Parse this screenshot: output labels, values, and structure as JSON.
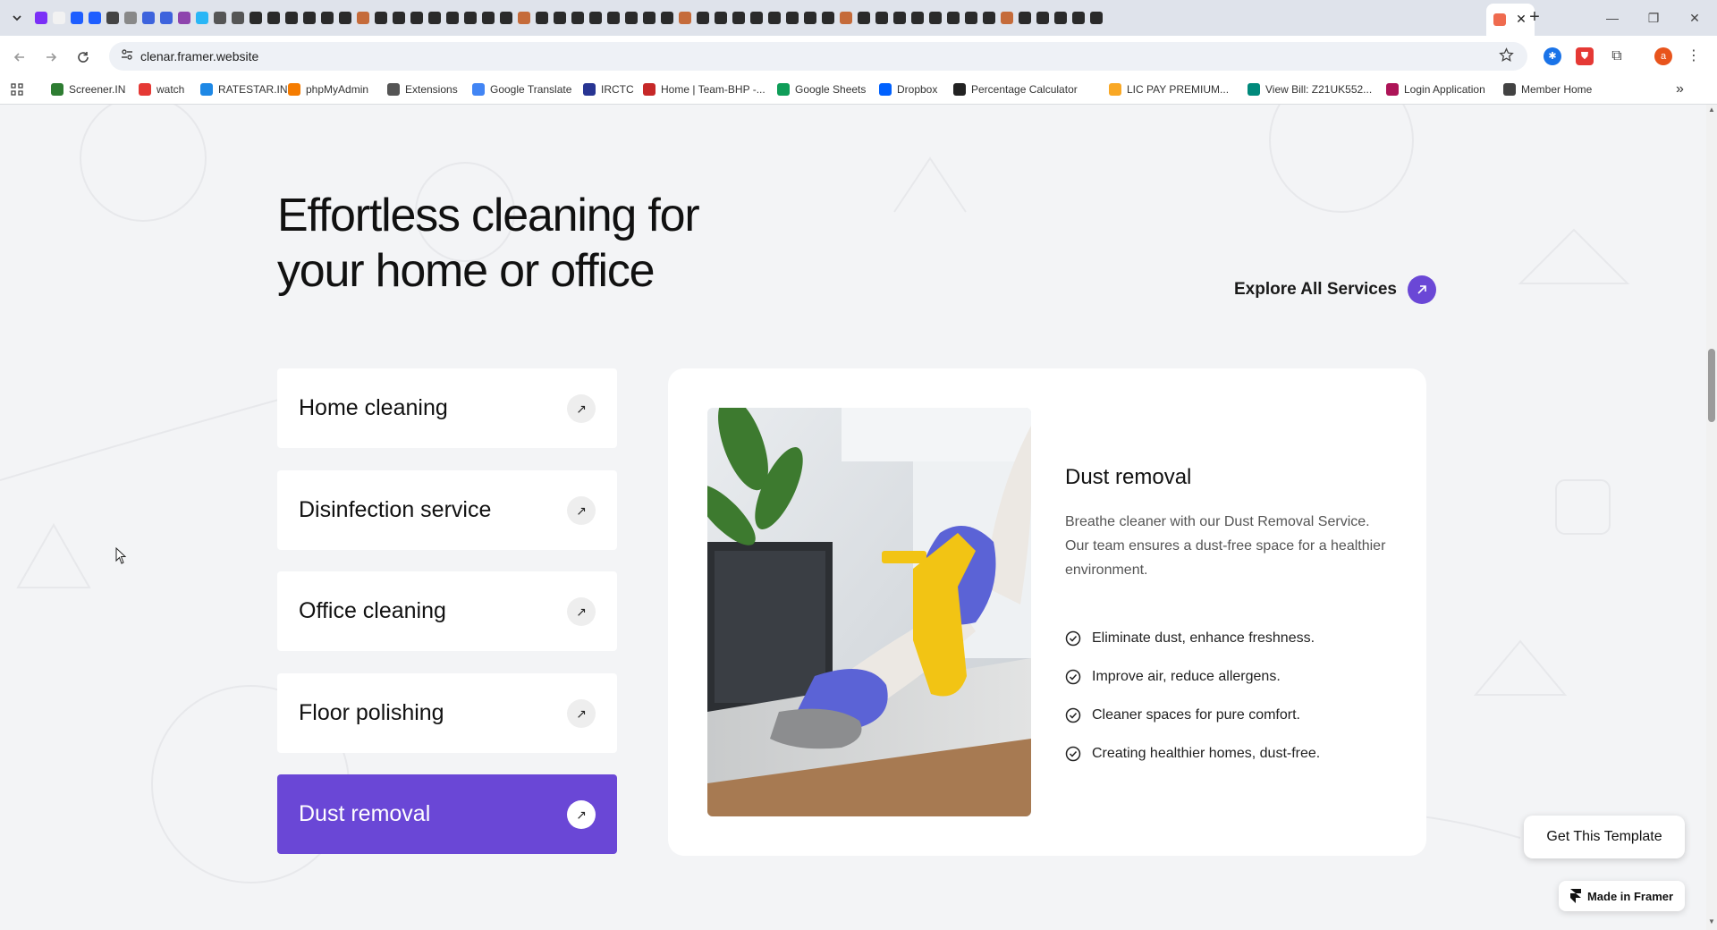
{
  "browser": {
    "tab_count_favicons": 60,
    "active_tab_close": "✕",
    "new_tab": "+",
    "window_controls": {
      "minimize": "—",
      "restore": "❐",
      "close": "✕"
    },
    "url": "clenar.framer.website",
    "profile_initial": "a",
    "icons": {
      "back": "arrow-left-icon",
      "forward": "arrow-right-icon",
      "reload": "reload-icon",
      "site_info": "tune-icon",
      "bookmark": "star-icon",
      "apps": "apps-grid-icon",
      "more_bookmarks": "chevron-double-right-icon"
    },
    "bookmarks": [
      {
        "label": "Screener.IN",
        "color": "#2e7d32"
      },
      {
        "label": "watch",
        "color": "#e53935"
      },
      {
        "label": "RATESTAR.IN",
        "color": "#1e88e5"
      },
      {
        "label": "phpMyAdmin",
        "color": "#f57c00"
      },
      {
        "label": "Extensions",
        "color": "#555555"
      },
      {
        "label": "Google Translate",
        "color": "#4285f4"
      },
      {
        "label": "IRCTC",
        "color": "#283593"
      },
      {
        "label": "Home | Team-BHP -...",
        "color": "#c62828"
      },
      {
        "label": "Google Sheets",
        "color": "#0f9d58"
      },
      {
        "label": "Dropbox",
        "color": "#0061fe"
      },
      {
        "label": "Percentage Calculator",
        "color": "#222222"
      },
      {
        "label": "LIC PAY PREMIUM...",
        "color": "#f9a825"
      },
      {
        "label": "View Bill: Z21UK552...",
        "color": "#00897b"
      },
      {
        "label": "Login Application",
        "color": "#ad1457"
      },
      {
        "label": "Member Home",
        "color": "#424242"
      }
    ],
    "bookmarks_overflow": "»"
  },
  "hero": {
    "headline_line1": "Effortless cleaning for",
    "headline_line2": "your home or office",
    "explore_label": "Explore All Services",
    "explore_icon": "arrow-up-right-icon"
  },
  "services": [
    {
      "label": "Home cleaning",
      "active": false
    },
    {
      "label": "Disinfection service",
      "active": false
    },
    {
      "label": "Office cleaning",
      "active": false
    },
    {
      "label": "Floor polishing",
      "active": false
    },
    {
      "label": "Dust removal",
      "active": true
    }
  ],
  "service_arrow": "↗",
  "detail": {
    "title": "Dust removal",
    "description": "Breathe cleaner with our Dust Removal Service. Our team ensures a dust-free space for a healthier environment.",
    "benefits": [
      "Eliminate dust, enhance freshness.",
      "Improve air, reduce allergens.",
      "Cleaner spaces for pure comfort.",
      "Creating healthier homes, dust-free."
    ],
    "image_subject": "gloved hand spraying and wiping a desk"
  },
  "floating": {
    "cta_label": "Get This Template",
    "badge_label": "Made in Framer"
  },
  "colors": {
    "accent": "#6a47d6",
    "page_bg": "#f3f4f6",
    "card_bg": "#ffffff"
  }
}
